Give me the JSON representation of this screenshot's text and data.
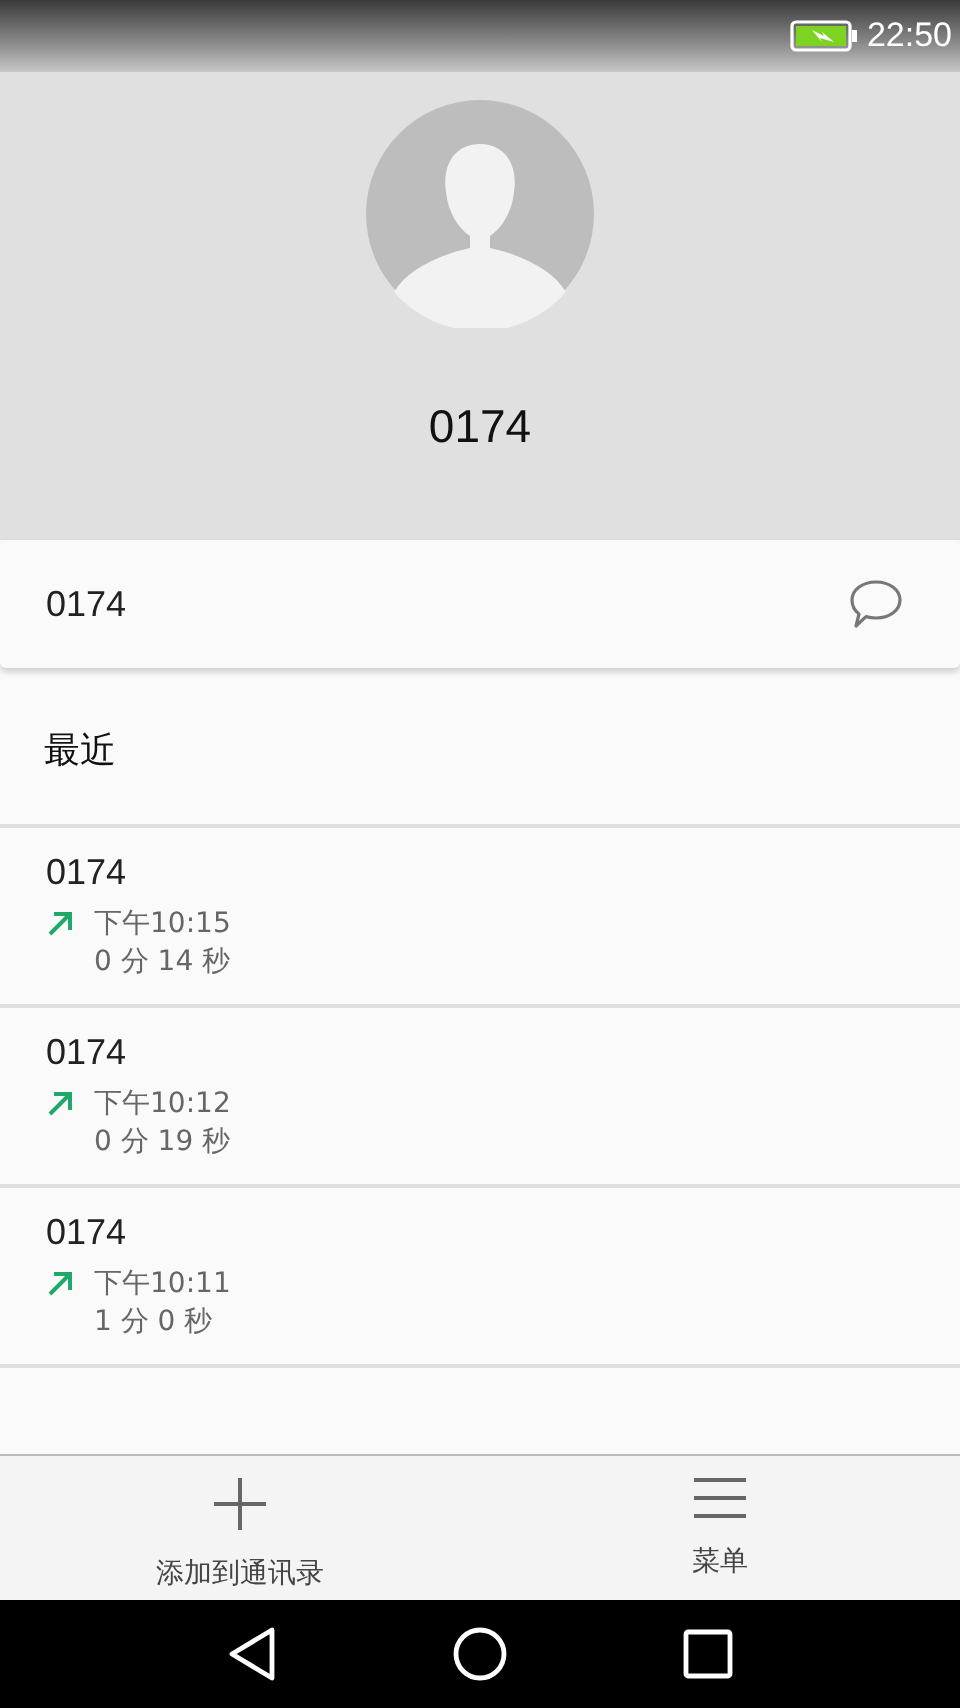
{
  "status_bar": {
    "time": "22:50",
    "charging": true
  },
  "contact": {
    "number": "0174"
  },
  "number_card": {
    "number": "0174"
  },
  "recent": {
    "title": "最近",
    "calls": [
      {
        "number": "0174",
        "kind": "outgoing",
        "time": "下午10:15",
        "duration": "0 分 14 秒"
      },
      {
        "number": "0174",
        "kind": "outgoing",
        "time": "下午10:12",
        "duration": "0 分 19 秒"
      },
      {
        "number": "0174",
        "kind": "outgoing",
        "time": "下午10:11",
        "duration": "1 分 0 秒"
      }
    ]
  },
  "bottom_actions": [
    {
      "kind": "add",
      "label": "添加到通讯录"
    },
    {
      "kind": "menu",
      "label": "菜单"
    }
  ]
}
